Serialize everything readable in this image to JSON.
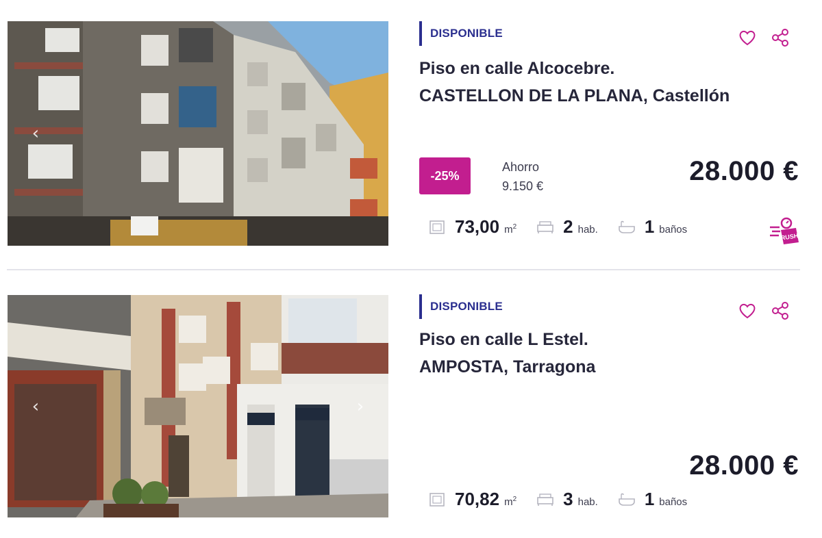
{
  "listings": [
    {
      "status": "DISPONIBLE",
      "title_line1": "Piso en calle Alcocebre.",
      "title_line2": "CASTELLON DE LA PLANA, Castellón",
      "discount": "-25%",
      "savings_label": "Ahorro",
      "savings_value": "9.150 €",
      "price": "28.000 €",
      "area_value": "73,00",
      "area_unit": "m",
      "area_sup": "2",
      "rooms_value": "2",
      "rooms_unit": "hab.",
      "baths_value": "1",
      "baths_unit": "baños",
      "has_rush_icon": true
    },
    {
      "status": "DISPONIBLE",
      "title_line1": "Piso en calle L Estel.",
      "title_line2": "AMPOSTA, Tarragona",
      "price": "28.000 €",
      "area_value": "70,82",
      "area_unit": "m",
      "area_sup": "2",
      "rooms_value": "3",
      "rooms_unit": "hab.",
      "baths_value": "1",
      "baths_unit": "baños"
    }
  ],
  "icons": {
    "favorite": "heart-icon",
    "share": "share-icon",
    "area": "area-icon",
    "rooms": "bed-icon",
    "baths": "bathtub-icon",
    "photo_prev": "chevron-left-icon",
    "photo_next": "chevron-right-icon",
    "rush": "rush-badge-icon"
  },
  "colors": {
    "accent": "#c21e8f",
    "status": "#2b2f8f",
    "text": "#1c1c2a"
  }
}
